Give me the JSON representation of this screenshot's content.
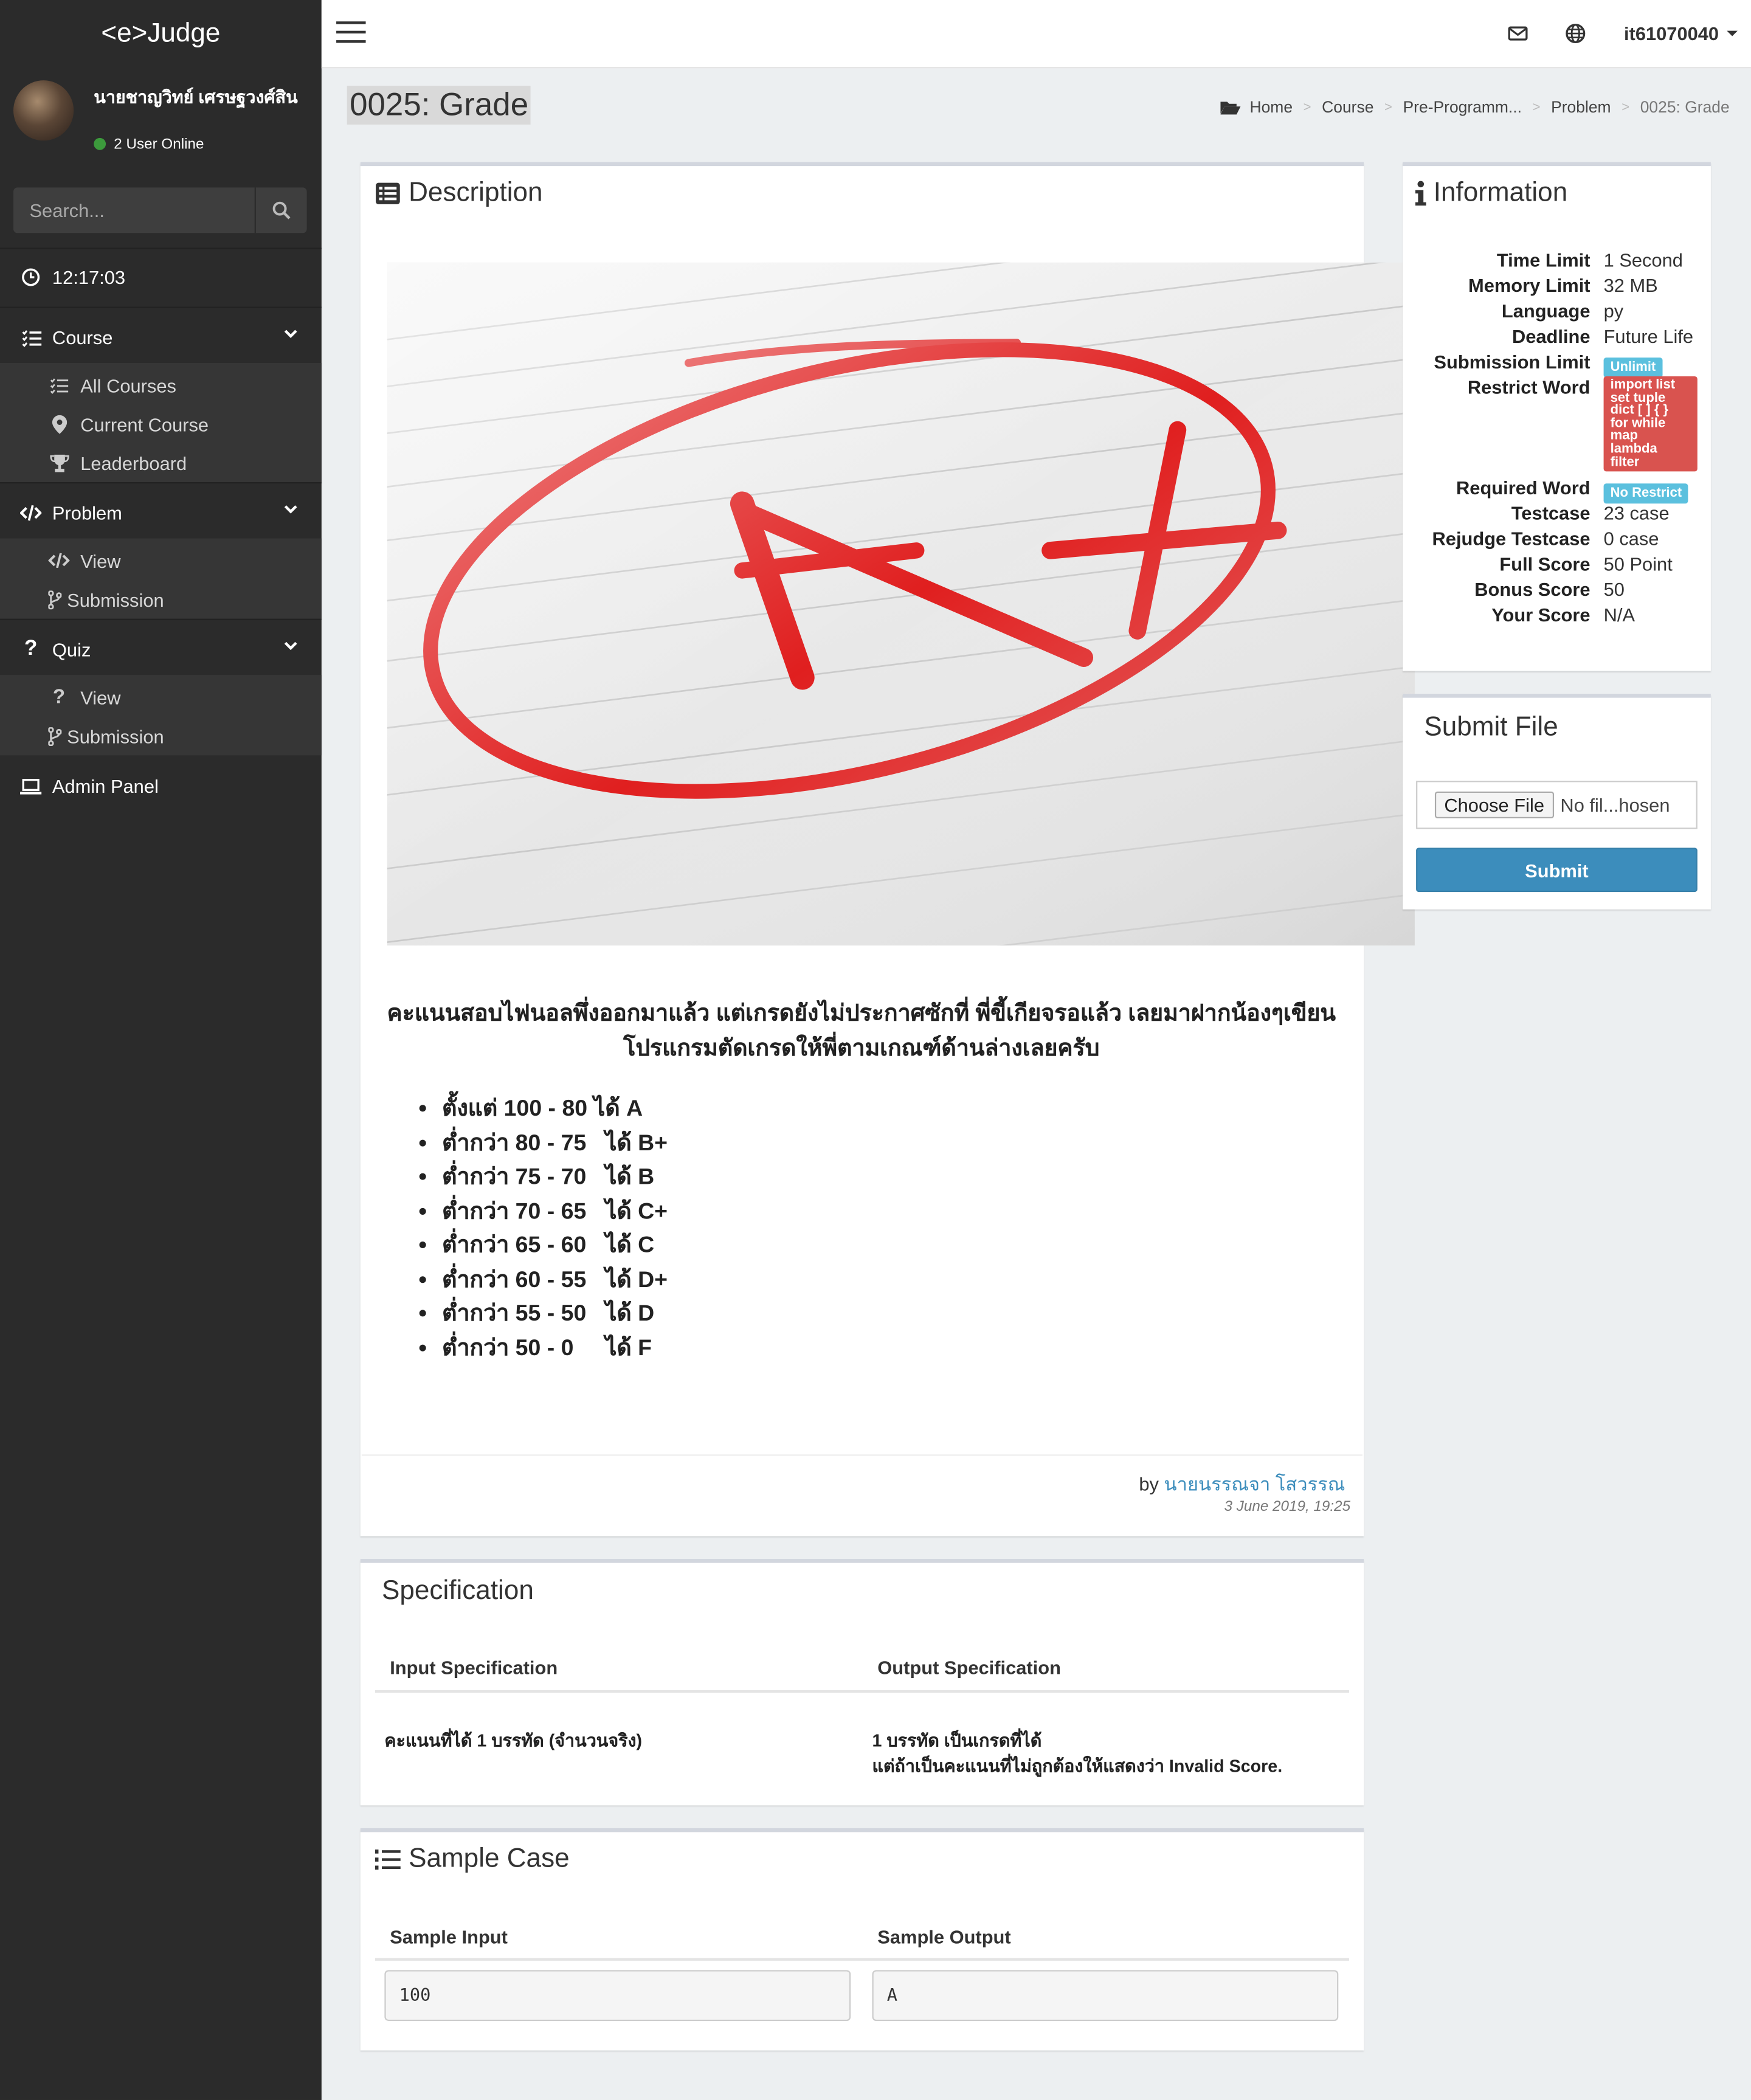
{
  "app": {
    "brand": "<e>Judge"
  },
  "user": {
    "name": "นายชาญวิทย์ เศรษฐวงศ์สิน",
    "online": "2 User Online",
    "username": "it61070040"
  },
  "search": {
    "placeholder": "Search..."
  },
  "sidebar": {
    "clock": "12:17:03",
    "course": {
      "label": "Course",
      "items": [
        "All Courses",
        "Current Course",
        "Leaderboard"
      ]
    },
    "problem": {
      "label": "Problem",
      "items": [
        "View",
        "Submission"
      ]
    },
    "quiz": {
      "label": "Quiz",
      "items": [
        "View",
        "Submission"
      ]
    },
    "admin": "Admin Panel"
  },
  "page": {
    "title": "0025: Grade"
  },
  "breadcrumb": [
    "Home",
    "Course",
    "Pre-Programm...",
    "Problem",
    "0025: Grade"
  ],
  "description": {
    "title": "Description",
    "heading": "คะแนนสอบไฟนอลพึ่งออกมาแล้ว แต่เกรดยังไม่ประกาศซักที่ พี่ขี้เกียจรอแล้ว เลยมาฝากน้องๆเขียนโปรแกรมตัดเกรดให้พี่ตามเกณฑ์ด้านล่างเลยครับ",
    "grades": [
      "ตั้งแต่ 100 - 80 ได้ A",
      "ต่ำกว่า 80 - 75   ได้ B+",
      "ต่ำกว่า 75 - 70   ได้ B",
      "ต่ำกว่า 70 - 65   ได้ C+",
      "ต่ำกว่า 65 - 60   ได้ C",
      "ต่ำกว่า 60 - 55   ได้ D+",
      "ต่ำกว่า 55 - 50   ได้ D",
      "ต่ำกว่า 50 - 0     ได้ F"
    ],
    "by": "by",
    "author": "นายนรรณจา โสวรรณ",
    "date": "3 June 2019, 19:25"
  },
  "information": {
    "title": "Information",
    "rows": [
      {
        "key": "Time Limit",
        "value": "1 Second"
      },
      {
        "key": "Memory Limit",
        "value": "32 MB"
      },
      {
        "key": "Language",
        "value": "py"
      },
      {
        "key": "Deadline",
        "value": "Future Life"
      },
      {
        "key": "Submission Limit",
        "badge": "Unlimit"
      },
      {
        "key": "Restrict Word",
        "badge_lines": [
          "import list",
          "set tuple",
          "dict [ ] { }",
          "for while",
          "map",
          "lambda",
          "filter"
        ]
      },
      {
        "key": "Required Word",
        "badge": "No Restrict"
      },
      {
        "key": "Testcase",
        "value": "23 case"
      },
      {
        "key": "Rejudge Testcase",
        "value": "0 case"
      },
      {
        "key": "Full Score",
        "value": "50 Point"
      },
      {
        "key": "Bonus Score",
        "value": "50"
      },
      {
        "key": "Your Score",
        "value": "N/A"
      }
    ]
  },
  "submit": {
    "title": "Submit File",
    "choose": "Choose File",
    "no_file": "No fil...hosen",
    "button": "Submit"
  },
  "specification": {
    "title": "Specification",
    "input_header": "Input Specification",
    "output_header": "Output Specification",
    "input": "คะแนนที่ได้ 1 บรรทัด (จำนวนจริง)",
    "output_lines": [
      "1 บรรทัด เป็นเกรดที่ได้",
      "แต่ถ้าเป็นคะแนนที่ไม่ถูกต้องให้แสดงว่า Invalid Score."
    ]
  },
  "sample": {
    "title": "Sample Case",
    "input_header": "Sample Input",
    "output_header": "Sample Output",
    "input": "100",
    "output": "A"
  },
  "colors": {
    "sidebar": "#2b2b2b",
    "accent": "#3c8dbc",
    "badge_blue": "#5bc0de",
    "badge_red": "#d9534f"
  }
}
